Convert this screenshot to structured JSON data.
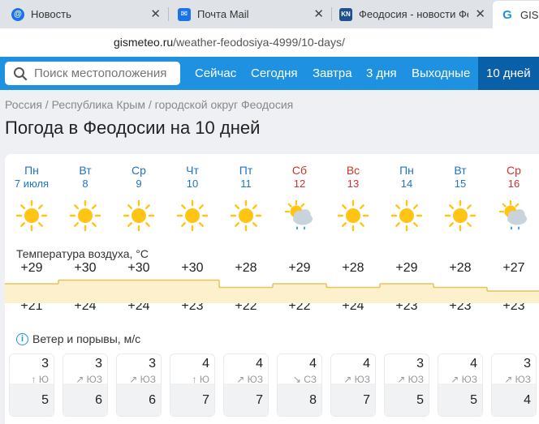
{
  "browser": {
    "tabs": [
      {
        "label": "Новость",
        "fav": "@",
        "color": "#1a73e8"
      },
      {
        "label": "Почта Mail",
        "fav": "✉",
        "color": "#1a73e8"
      },
      {
        "label": "Феодосия - новости Феод",
        "fav": "KN",
        "color": "#1f4f8c"
      },
      {
        "label": "GISM",
        "fav": "G",
        "color": "#1e92e0"
      }
    ],
    "url_host": "gismeteo.ru",
    "url_path": "/weather-feodosiya-4999/10-days/"
  },
  "nav": {
    "search_placeholder": "Поиск местоположения",
    "links": [
      "Сейчас",
      "Сегодня",
      "Завтра",
      "3 дня",
      "Выходные",
      "10 дней"
    ],
    "active": "10 дней"
  },
  "breadcrumb": [
    "Россия",
    "Республика Крым",
    "городской округ Феодосия"
  ],
  "page_title": "Погода в Феодосии на 10 дней",
  "temp_label": "Температура воздуха, °C",
  "wind_label": "Ветер и порывы, м/с",
  "days": [
    {
      "name": "Пн",
      "date": "7 июля",
      "weekend": false,
      "icon": "sun",
      "tmax": "+29",
      "tmin": "+21",
      "max_num": 29,
      "min_num": 21,
      "wind": "3",
      "dir_arrow": "↑",
      "dir": "Ю",
      "gust": "5"
    },
    {
      "name": "Вт",
      "date": "8",
      "weekend": false,
      "icon": "sun",
      "tmax": "+30",
      "tmin": "+24",
      "max_num": 30,
      "min_num": 24,
      "wind": "3",
      "dir_arrow": "↗",
      "dir": "ЮЗ",
      "gust": "6"
    },
    {
      "name": "Ср",
      "date": "9",
      "weekend": false,
      "icon": "sun",
      "tmax": "+30",
      "tmin": "+24",
      "max_num": 30,
      "min_num": 24,
      "wind": "3",
      "dir_arrow": "↗",
      "dir": "ЮЗ",
      "gust": "6"
    },
    {
      "name": "Чт",
      "date": "10",
      "weekend": false,
      "icon": "sun",
      "tmax": "+30",
      "tmin": "+23",
      "max_num": 30,
      "min_num": 23,
      "wind": "4",
      "dir_arrow": "↑",
      "dir": "Ю",
      "gust": "7"
    },
    {
      "name": "Пт",
      "date": "11",
      "weekend": false,
      "icon": "sun",
      "tmax": "+28",
      "tmin": "+22",
      "max_num": 28,
      "min_num": 22,
      "wind": "4",
      "dir_arrow": "↗",
      "dir": "ЮЗ",
      "gust": "7"
    },
    {
      "name": "Сб",
      "date": "12",
      "weekend": true,
      "icon": "sun-cloud-rain",
      "tmax": "+29",
      "tmin": "+22",
      "max_num": 29,
      "min_num": 22,
      "wind": "4",
      "dir_arrow": "↘",
      "dir": "СЗ",
      "gust": "8"
    },
    {
      "name": "Вс",
      "date": "13",
      "weekend": true,
      "icon": "sun",
      "tmax": "+28",
      "tmin": "+24",
      "max_num": 28,
      "min_num": 24,
      "wind": "4",
      "dir_arrow": "↗",
      "dir": "ЮЗ",
      "gust": "7"
    },
    {
      "name": "Пн",
      "date": "14",
      "weekend": false,
      "icon": "sun",
      "tmax": "+29",
      "tmin": "+23",
      "max_num": 29,
      "min_num": 23,
      "wind": "3",
      "dir_arrow": "↗",
      "dir": "ЮЗ",
      "gust": "5"
    },
    {
      "name": "Вт",
      "date": "15",
      "weekend": false,
      "icon": "sun",
      "tmax": "+28",
      "tmin": "+23",
      "max_num": 28,
      "min_num": 23,
      "wind": "4",
      "dir_arrow": "↗",
      "dir": "ЮЗ",
      "gust": "5"
    },
    {
      "name": "Ср",
      "date": "16",
      "weekend": true,
      "icon": "sun-cloud-rain",
      "tmax": "+27",
      "tmin": "+23",
      "max_num": 27,
      "min_num": 23,
      "wind": "3",
      "dir_arrow": "↗",
      "dir": "ЮЗ",
      "gust": "4"
    }
  ],
  "colors": {
    "accent": "#1e92e0",
    "active_nav": "#0a5fa9",
    "weekday": "#1e72c8",
    "weekend": "#d0322b",
    "sun": "#ffc414",
    "band_fill": "#fdf0cc",
    "band_line": "#e8c25c"
  }
}
